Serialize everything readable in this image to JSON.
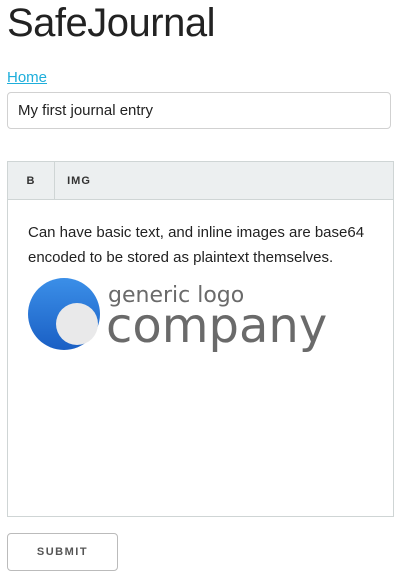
{
  "app": {
    "title": "SafeJournal"
  },
  "nav": {
    "home_label": "Home"
  },
  "entry": {
    "title_value": "My first journal entry"
  },
  "editor": {
    "toolbar": {
      "bold_label": "B",
      "image_label": "IMG"
    },
    "body_text": "Can have basic text, and inline images are base64 encoded to be stored as plaintext themselves.",
    "image": {
      "icon": "generic-company-logo",
      "line1": "generic logo",
      "line2": "company",
      "colors": {
        "circle_light": "#3b8fe8",
        "circle_dark": "#1a5fc4",
        "text": "#6a6a6a",
        "inner": "#e9e9ea"
      }
    }
  },
  "form": {
    "submit_label": "SUBMIT"
  },
  "colors": {
    "link": "#1eaedb",
    "toolbar_bg": "#eceff0",
    "border": "#cfd5d5"
  }
}
